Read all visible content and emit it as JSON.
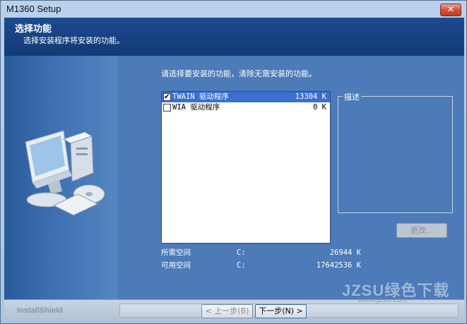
{
  "window": {
    "title": "M1360 Setup",
    "close_glyph": "✕"
  },
  "header": {
    "title": "选择功能",
    "subtitle": "选择安装程序将安装的功能。"
  },
  "main": {
    "instruction": "请选择要安装的功能，清除无需安装的功能。",
    "features": [
      {
        "name": "TWAIN 驱动程序",
        "size": "13304 K",
        "checked": true,
        "selected": true
      },
      {
        "name": "WIA 驱动程序",
        "size": "0 K",
        "checked": false,
        "selected": false
      }
    ],
    "description_label": "描述",
    "change_button": "更改...",
    "space": {
      "required_label": "所需空间",
      "required_drive": "C:",
      "required_value": "26944 K",
      "available_label": "可用空间",
      "available_drive": "C:",
      "available_value": "17642536 K"
    }
  },
  "footer": {
    "brand": "InstallShield",
    "back_button": "< 上一步(B)",
    "next_button": "下一步(N) >"
  },
  "watermark": {
    "main": "JZSU绿色下载",
    "sub": "www.jzsu.com"
  },
  "colors": {
    "header_bg": "#1d4a8f",
    "panel_bg": "#4d7ab8",
    "selected_row": "#3a6fd0",
    "close_button": "#d1543c"
  },
  "icons": [
    "close-icon",
    "checkbox-icon",
    "computer-icon"
  ]
}
